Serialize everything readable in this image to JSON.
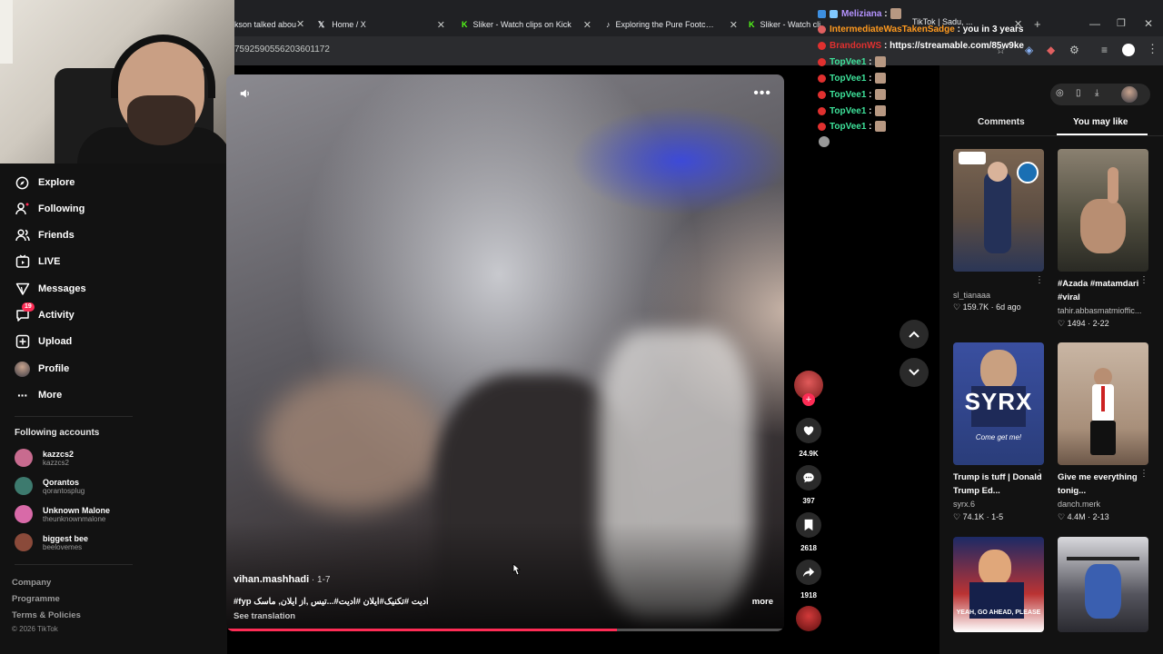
{
  "browser": {
    "tabs": [
      {
        "label": "kson talked abou",
        "icon": ""
      },
      {
        "label": "Home / X",
        "icon": "x"
      },
      {
        "label": "Sliker - Watch clips on Kick",
        "icon": "k"
      },
      {
        "label": "Exploring the Pure Footcraft Ju",
        "icon": "tiktok"
      },
      {
        "label": "Sliker - Watch cli",
        "icon": "k"
      }
    ],
    "url": "7592590556203601172"
  },
  "chat": [
    {
      "user": "Meliziana",
      "text": ":",
      "color": "#b493ff"
    },
    {
      "user": "IntermediateWasTakenSadge",
      "text": ": you in 3 years",
      "color": "#ff9a1f"
    },
    {
      "user": "BrandonWS",
      "text": ": https://streamable.com/85w9ke",
      "color": "#e0302f"
    },
    {
      "user": "TopVee1",
      "text": ":",
      "color": "#3ee39b"
    },
    {
      "user": "TopVee1",
      "text": ":",
      "color": "#3ee39b"
    },
    {
      "user": "TopVee1",
      "text": ":",
      "color": "#3ee39b"
    },
    {
      "user": "TopVee1",
      "text": ":",
      "color": "#3ee39b"
    },
    {
      "user": "TopVee1",
      "text": ":",
      "color": "#3ee39b"
    }
  ],
  "chat_tab_label": "TikTok | Sadu, ...",
  "sidebar": {
    "nav": [
      {
        "label": "Explore",
        "icon": "compass-icon"
      },
      {
        "label": "Following",
        "icon": "following-icon"
      },
      {
        "label": "Friends",
        "icon": "friends-icon"
      },
      {
        "label": "LIVE",
        "icon": "live-icon"
      },
      {
        "label": "Messages",
        "icon": "messages-icon"
      },
      {
        "label": "Activity",
        "icon": "activity-icon",
        "badge": "19"
      },
      {
        "label": "Upload",
        "icon": "upload-icon"
      },
      {
        "label": "Profile",
        "icon": "profile-icon"
      },
      {
        "label": "More",
        "icon": "more-icon"
      }
    ],
    "following_title": "Following accounts",
    "accounts": [
      {
        "name": "kazzcs2",
        "handle": "kazzcs2",
        "color": "#c86b8f"
      },
      {
        "name": "Qorantos",
        "handle": "qorantosplug",
        "color": "#3d7a6e"
      },
      {
        "name": "Unknown Malone",
        "handle": "theunknownmalone",
        "color": "#d86aa8"
      },
      {
        "name": "biggest bee",
        "handle": "beelovemes",
        "color": "#8a4a3a"
      }
    ],
    "footer": [
      "Company",
      "Programme",
      "Terms & Policies"
    ],
    "copyright": "© 2026 TikTok"
  },
  "video": {
    "author": "vihan.mashhadi",
    "date": " · 1-7",
    "caption": "#fyp ادیت #تکنیک#ایلان #ادیت#...تیس ,از ایلان, ماسک",
    "more": "more",
    "see_translation": "See translation",
    "progress": 0.7
  },
  "actions": {
    "likes": "24.9K",
    "comments": "397",
    "saves": "2618",
    "shares": "1918"
  },
  "right_panel": {
    "tab_comments": "Comments",
    "tab_you_may_like": "You may like",
    "items": [
      {
        "caption": "",
        "user": "sl_tianaaa",
        "likes": "159.7K",
        "meta": "6d ago",
        "bg": "#6e5a4c"
      },
      {
        "caption": "#Azada #matamdari #viral",
        "user": "tahir.abbasmatmioffic...",
        "likes": "1494",
        "meta": "2-22",
        "bg": "#4c4a3c"
      },
      {
        "caption": "Trump is tuff | Donald Trump Ed...",
        "user": "syrx.6",
        "likes": "74.1K",
        "meta": "1-5",
        "bg": "#2a3d7a",
        "overlay": "SYRX",
        "sub": "Come get me!"
      },
      {
        "caption": "Give me everything tonig...",
        "user": "danch.merk",
        "likes": "4.4M",
        "meta": "2-13",
        "bg": "#b39a86"
      },
      {
        "caption": "",
        "user": "",
        "likes": "",
        "meta": "",
        "bg": "#1c2a66",
        "sub": "YEAH, GO AHEAD, PLEASE"
      },
      {
        "caption": "",
        "user": "",
        "likes": "",
        "meta": "",
        "bg": "#3a3a44"
      }
    ]
  }
}
